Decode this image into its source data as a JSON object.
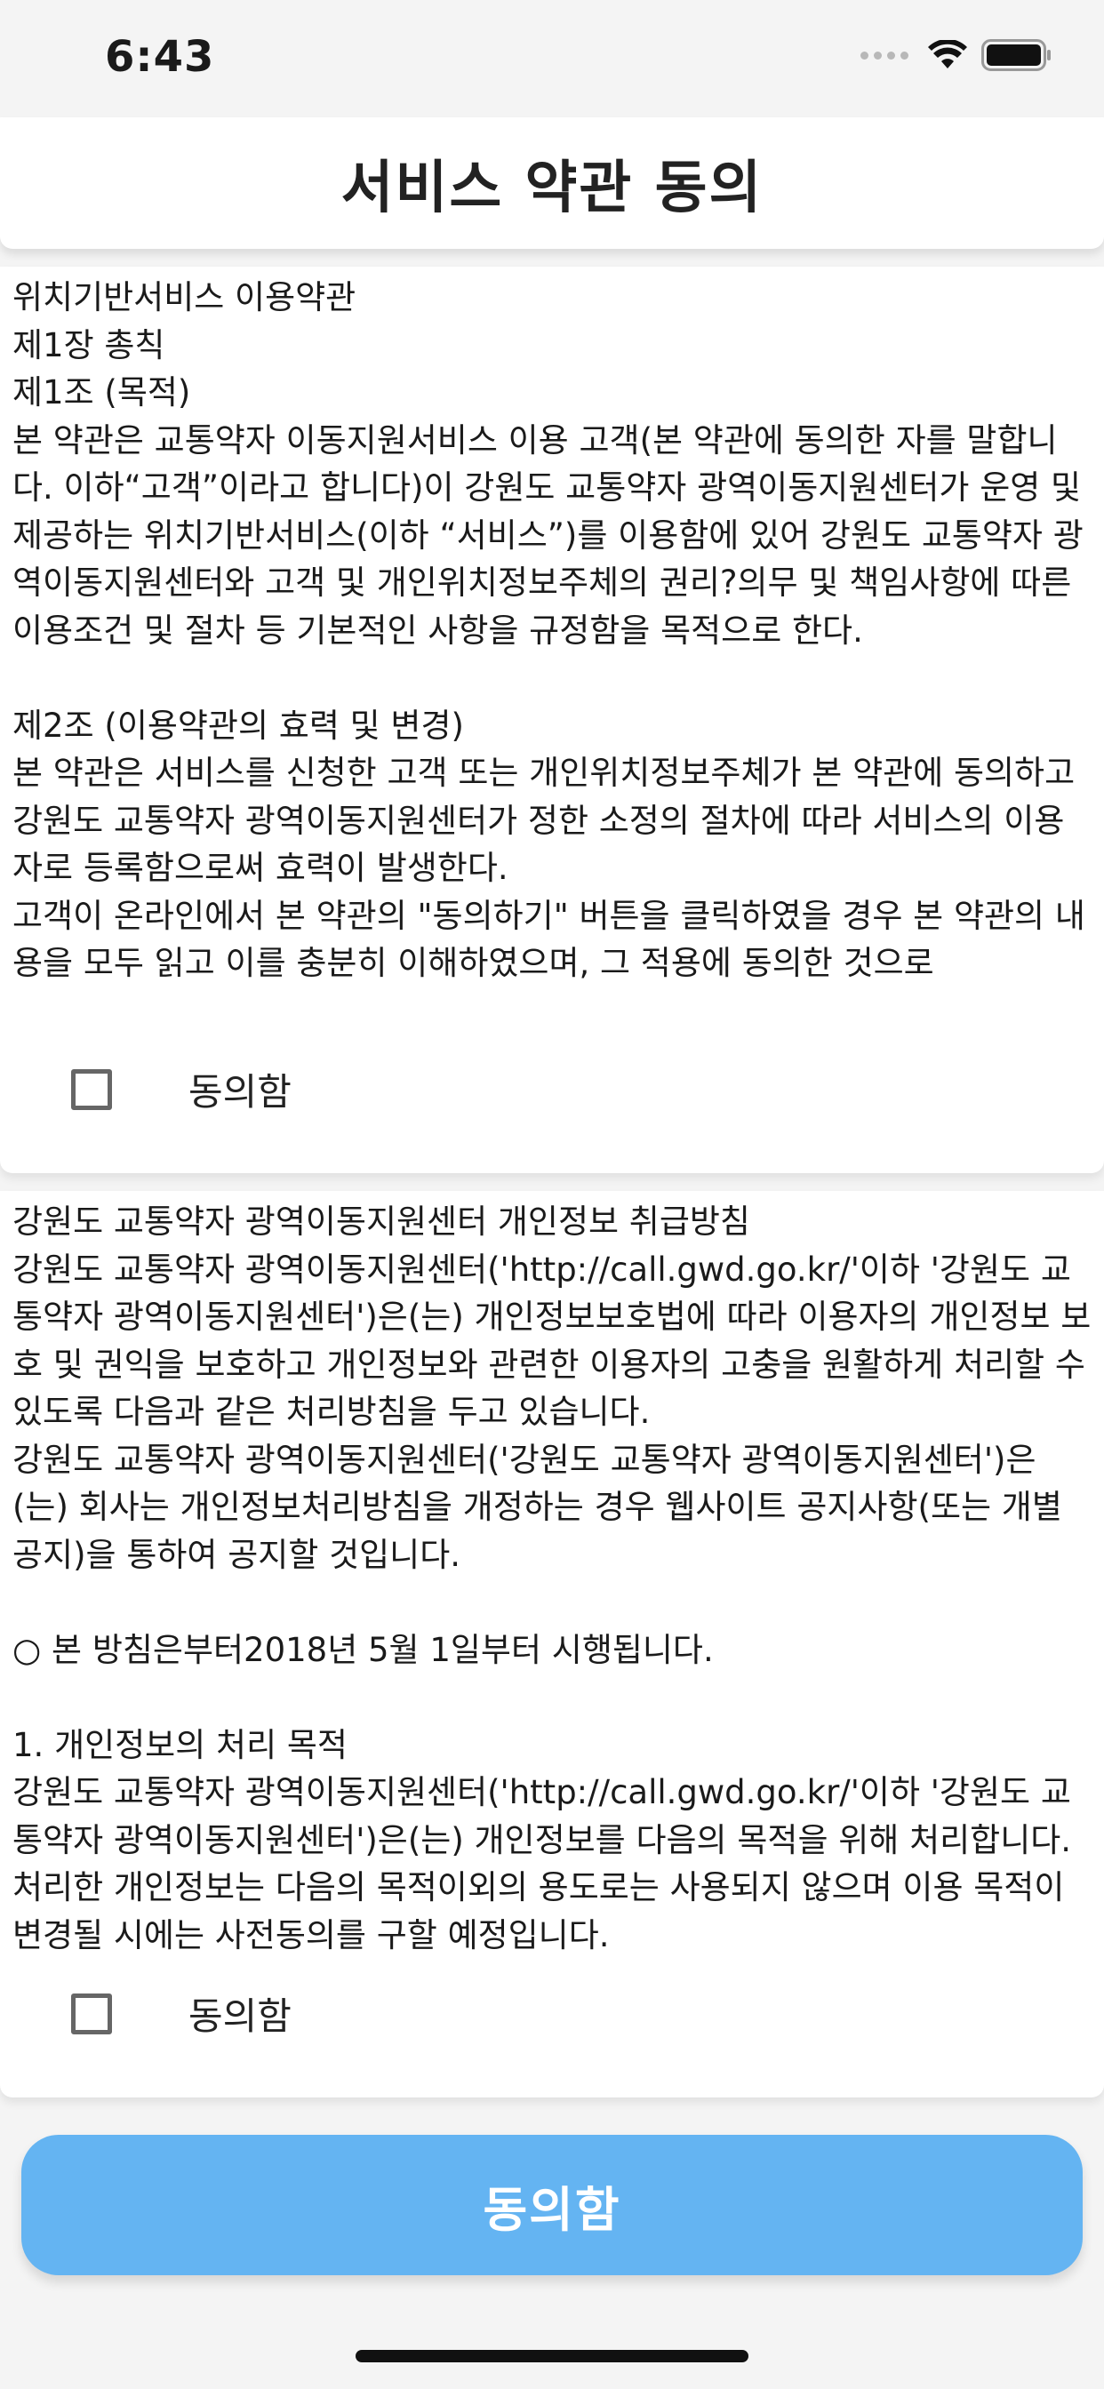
{
  "status_bar": {
    "time": "6:43",
    "icons": [
      "cellular-signal-icon",
      "wifi-icon",
      "battery-icon"
    ]
  },
  "header": {
    "title": "서비스 약관 동의"
  },
  "location_terms": {
    "text": "위치기반서비스 이용약관\n제1장 총칙\n제1조 (목적)\n본 약관은 교통약자 이동지원서비스 이용 고객(본 약관에 동의한 자를 말합니다. 이하“고객”이라고 합니다)이 강원도 교통약자 광역이동지원센터가 운영 및 제공하는 위치기반서비스(이하 “서비스”)를 이용함에 있어 강원도 교통약자 광역이동지원센터와 고객 및 개인위치정보주체의 권리?의무 및 책임사항에 따른 이용조건 및 절차 등 기본적인 사항을 규정함을 목적으로 한다.\n\n제2조 (이용약관의 효력 및 변경)\n본 약관은 서비스를 신청한 고객 또는 개인위치정보주체가 본 약관에 동의하고 강원도 교통약자 광역이동지원센터가 정한 소정의 절차에 따라 서비스의 이용자로 등록함으로써 효력이 발생한다.\n고객이 온라인에서 본 약관의 \"동의하기\" 버튼을 클릭하였을 경우 본 약관의 내용을 모두 읽고 이를 충분히 이해하였으며, 그 적용에 동의한 것으로",
    "agree_label": "동의함",
    "checked": false
  },
  "privacy_policy": {
    "text": "강원도 교통약자 광역이동지원센터 개인정보 취급방침\n강원도 교통약자 광역이동지원센터('http://call.gwd.go.kr/'이하 '강원도 교통약자 광역이동지원센터')은(는) 개인정보보호법에 따라 이용자의 개인정보 보호 및 권익을 보호하고 개인정보와 관련한 이용자의 고충을 원활하게 처리할 수 있도록 다음과 같은 처리방침을 두고 있습니다.\n강원도 교통약자 광역이동지원센터('강원도 교통약자 광역이동지원센터')은(는) 회사는 개인정보처리방침을 개정하는 경우 웹사이트 공지사항(또는 개별공지)을 통하여 공지할 것입니다.\n\n○ 본 방침은부터2018년 5월 1일부터 시행됩니다.\n\n1. 개인정보의 처리 목적\n강원도 교통약자 광역이동지원센터('http://call.gwd.go.kr/'이하 '강원도 교통약자 광역이동지원센터')은(는) 개인정보를 다음의 목적을 위해 처리합니다. 처리한 개인정보는 다음의 목적이외의 용도로는 사용되지 않으며 이용 목적이 변경될 시에는 사전동의를 구할 예정입니다.",
    "agree_label": "동의함",
    "checked": false
  },
  "footer": {
    "agree_button_label": "동의함"
  },
  "colors": {
    "background": "#f4f4f4",
    "card": "#ffffff",
    "button": "#64b4f2",
    "button_text": "#ffffff"
  }
}
